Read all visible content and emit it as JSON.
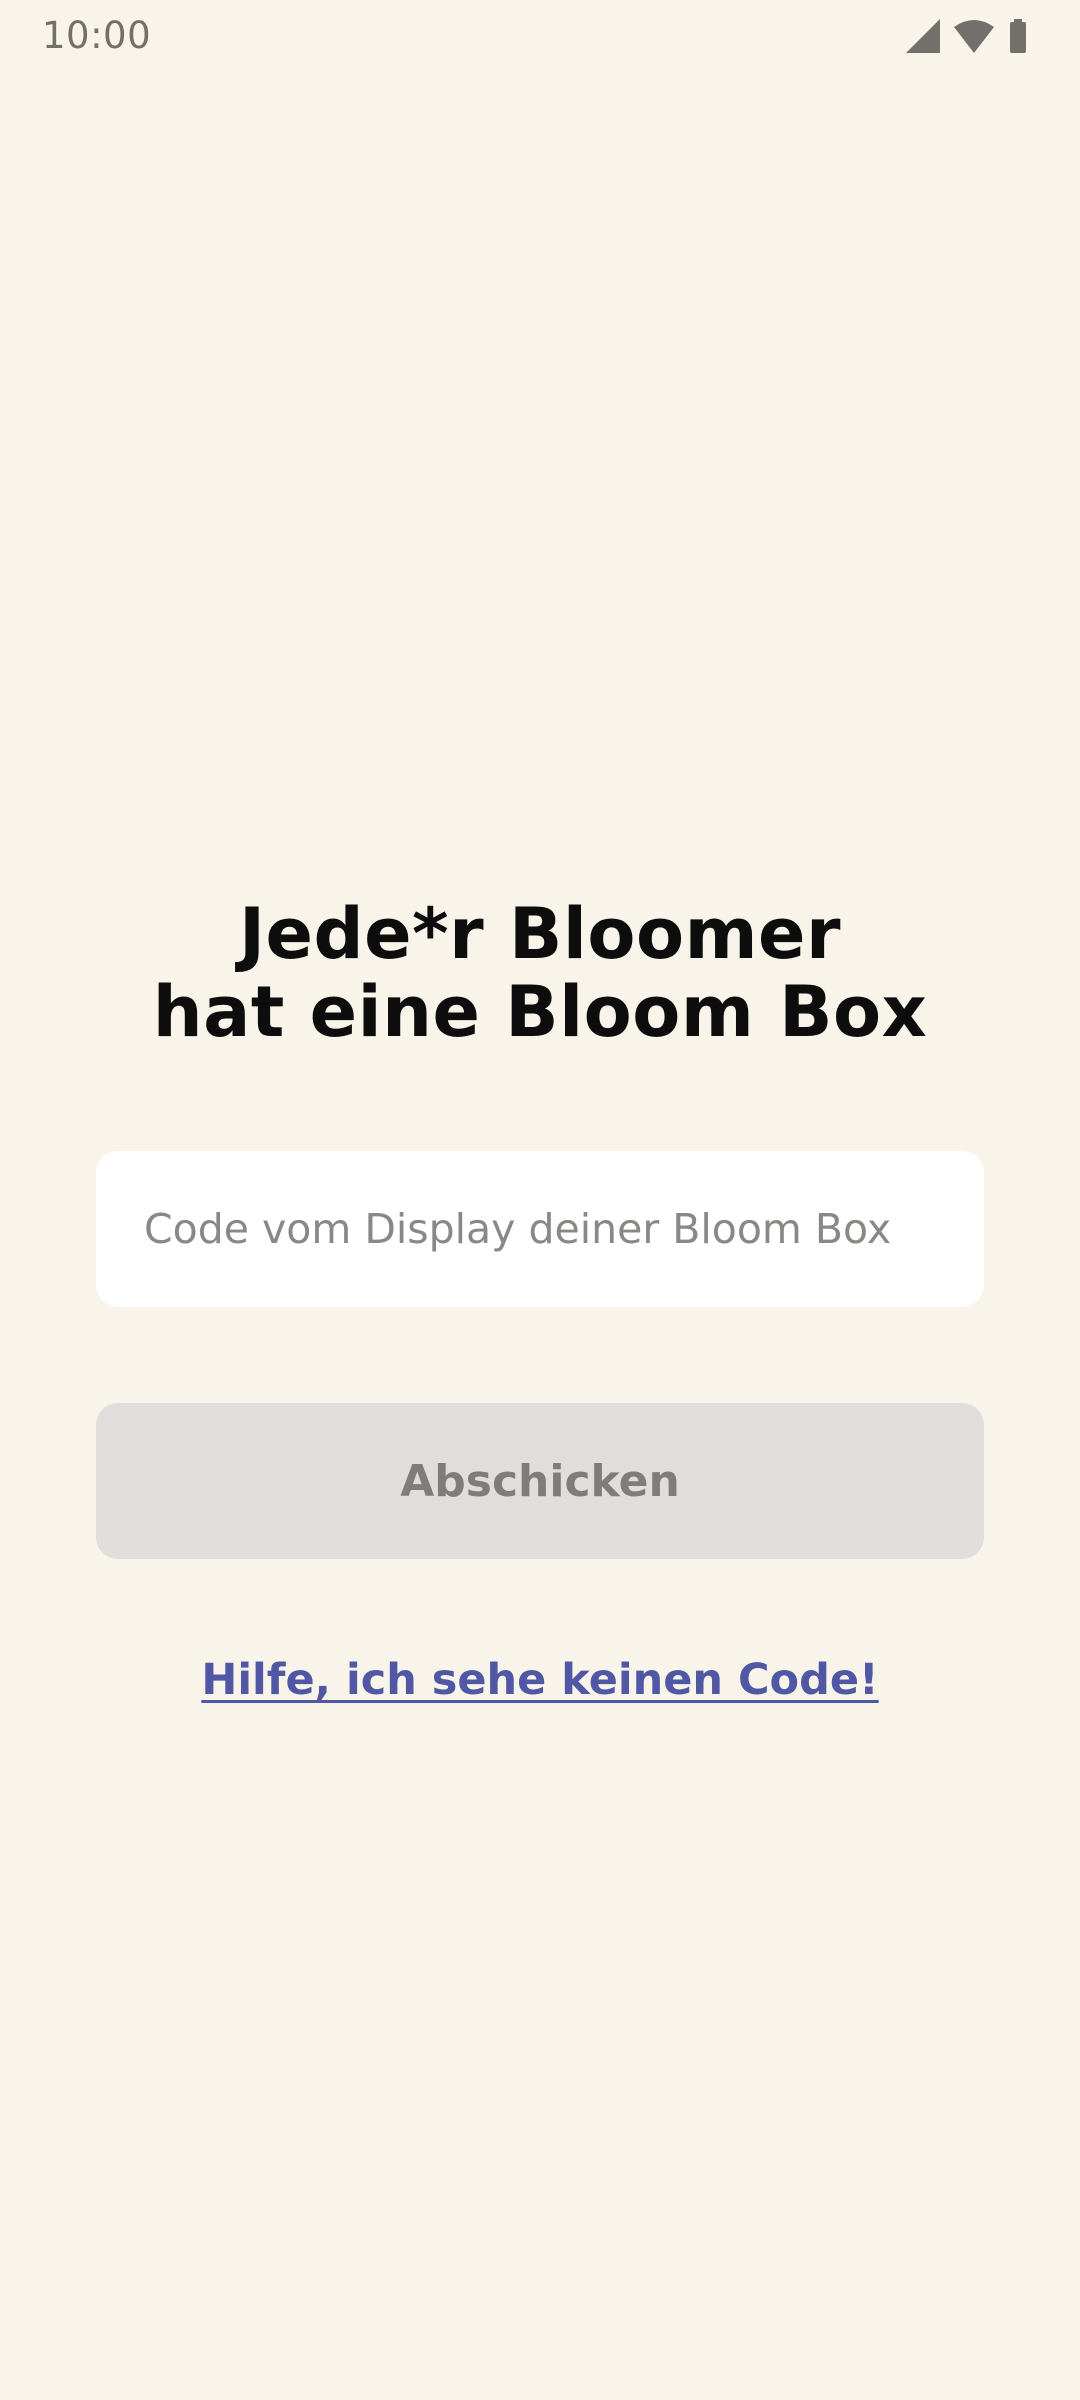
{
  "status_bar": {
    "time": "10:00",
    "icons": [
      "cellular-signal-icon",
      "wifi-icon",
      "battery-icon"
    ]
  },
  "headline": {
    "line1": "Jede*r Bloomer",
    "line2": "hat eine Bloom Box"
  },
  "code_input": {
    "value": "",
    "placeholder": "Code vom Display deiner Bloom Box"
  },
  "submit": {
    "label": "Abschicken",
    "enabled": false
  },
  "help_link": {
    "label": "Hilfe, ich sehe keinen Code!"
  },
  "colors": {
    "background": "#f8f4e9",
    "link": "#5057a4",
    "button_disabled": "#dfdedd"
  }
}
